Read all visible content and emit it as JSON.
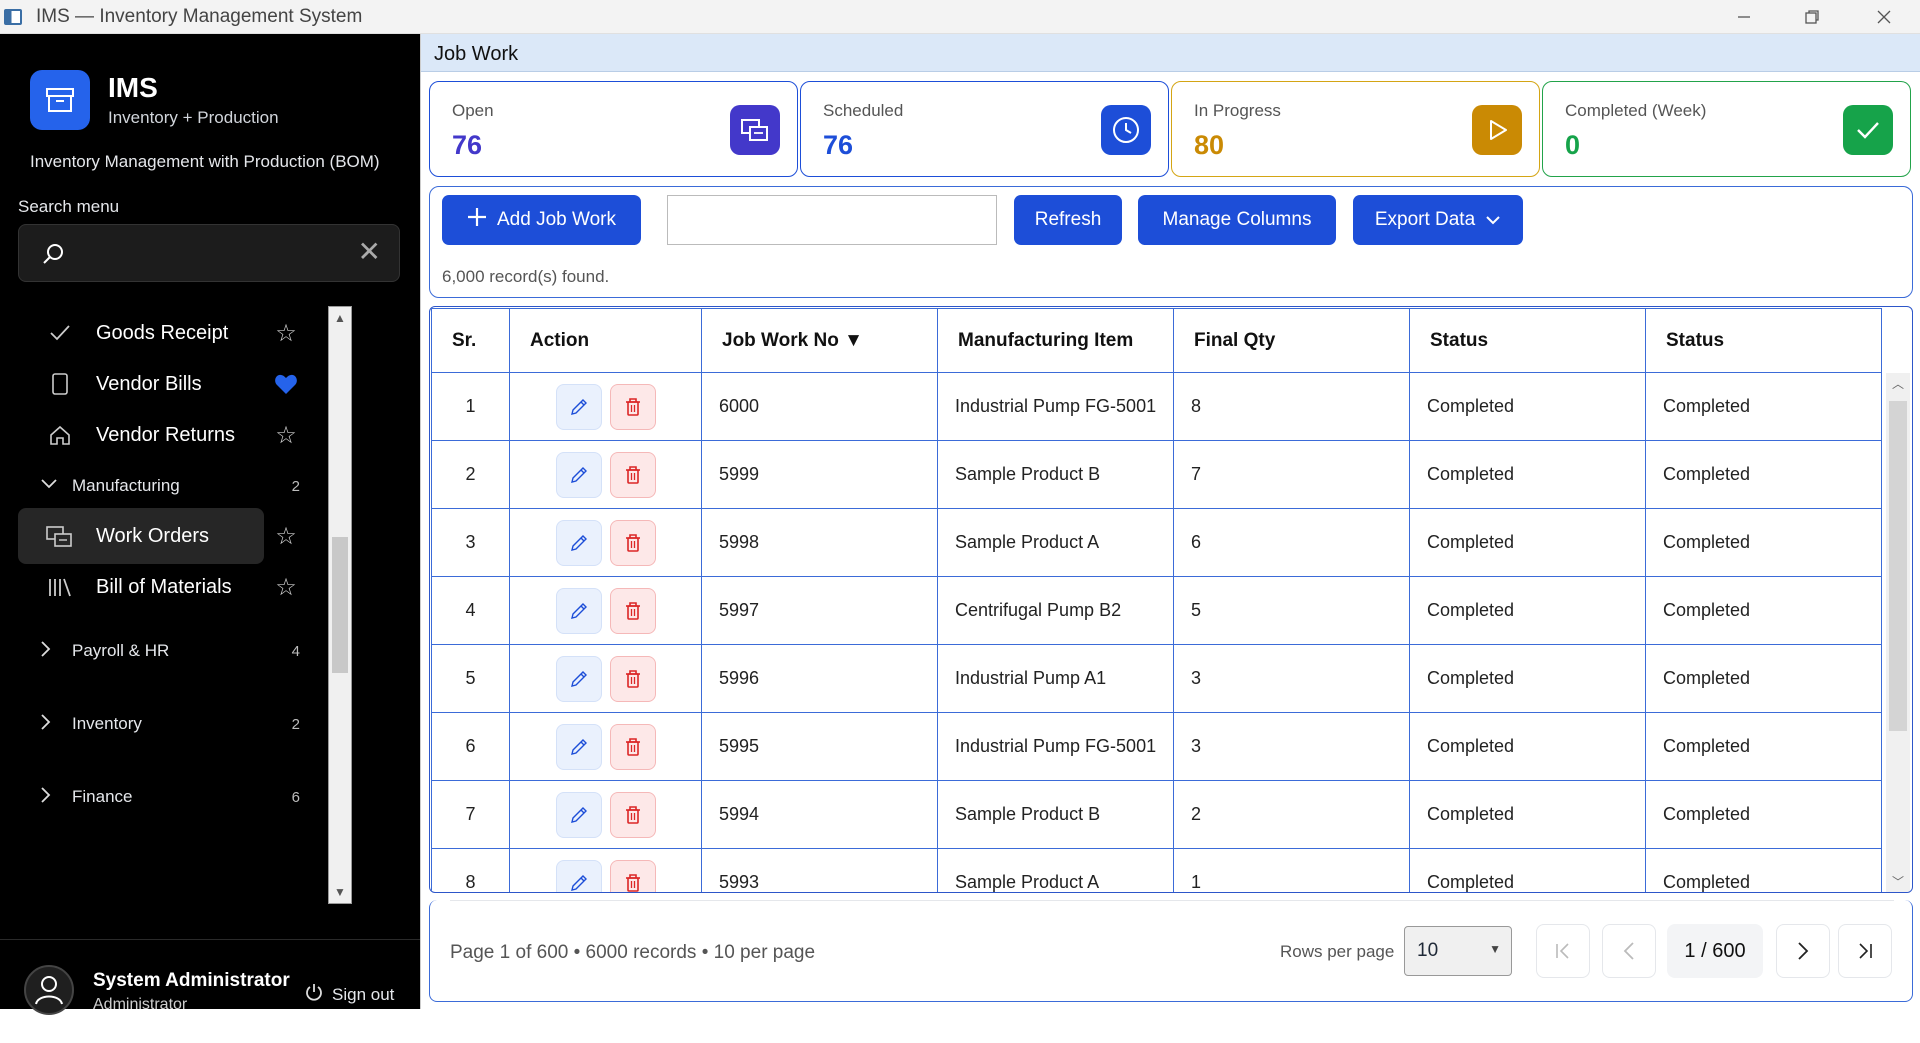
{
  "window": {
    "title": "IMS — Inventory Management System"
  },
  "brand": {
    "title": "IMS",
    "subtitle": "Inventory + Production",
    "tagline": "Inventory Management with Production (BOM)"
  },
  "search": {
    "label": "Search menu",
    "value": ""
  },
  "nav": {
    "items": [
      {
        "label": "Goods Receipt",
        "icon": "check-icon",
        "starred": false
      },
      {
        "label": "Vendor Bills",
        "icon": "document-icon",
        "starred": true
      },
      {
        "label": "Vendor Returns",
        "icon": "home-icon",
        "starred": false
      }
    ],
    "groups": [
      {
        "label": "Manufacturing",
        "count": "2",
        "expanded": true,
        "items": [
          {
            "label": "Work Orders",
            "icon": "work-orders-icon",
            "active": true
          },
          {
            "label": "Bill of Materials",
            "icon": "library-icon",
            "active": false
          }
        ]
      },
      {
        "label": "Payroll & HR",
        "count": "4",
        "expanded": false
      },
      {
        "label": "Inventory",
        "count": "2",
        "expanded": false
      },
      {
        "label": "Finance",
        "count": "6",
        "expanded": false
      }
    ]
  },
  "user": {
    "name": "System Administrator",
    "role": "Administrator",
    "signout": "Sign out"
  },
  "page": {
    "title": "Job Work"
  },
  "stats": [
    {
      "label": "Open",
      "value": "76",
      "color": "#4338ca",
      "icon": "work-orders-icon"
    },
    {
      "label": "Scheduled",
      "value": "76",
      "color": "#1d4ed8",
      "icon": "clock-icon"
    },
    {
      "label": "In Progress",
      "value": "80",
      "color": "#ca8a04",
      "icon": "play-icon"
    },
    {
      "label": "Completed (Week)",
      "value": "0",
      "color": "#16a34a",
      "icon": "check-icon"
    }
  ],
  "toolbar": {
    "add_label": "Add Job Work",
    "search_value": "",
    "refresh_label": "Refresh",
    "columns_label": "Manage Columns",
    "export_label": "Export Data",
    "records_text": "6,000 record(s) found."
  },
  "table": {
    "columns": [
      "Sr.",
      "Action",
      "Job Work No ▼",
      "Manufacturing Item",
      "Final Qty",
      "Status",
      "Status"
    ],
    "rows": [
      [
        "1",
        "6000",
        "Industrial Pump FG-5001",
        "8",
        "Completed",
        "Completed"
      ],
      [
        "2",
        "5999",
        "Sample Product B",
        "7",
        "Completed",
        "Completed"
      ],
      [
        "3",
        "5998",
        "Sample Product A",
        "6",
        "Completed",
        "Completed"
      ],
      [
        "4",
        "5997",
        "Centrifugal Pump B2",
        "5",
        "Completed",
        "Completed"
      ],
      [
        "5",
        "5996",
        "Industrial Pump A1",
        "3",
        "Completed",
        "Completed"
      ],
      [
        "6",
        "5995",
        "Industrial Pump FG-5001",
        "3",
        "Completed",
        "Completed"
      ],
      [
        "7",
        "5994",
        "Sample Product B",
        "2",
        "Completed",
        "Completed"
      ],
      [
        "8",
        "5993",
        "Sample Product A",
        "1",
        "Completed",
        "Completed"
      ]
    ]
  },
  "pager": {
    "info": "Page 1 of 600  •  6000 records  •  10 per page",
    "rows_label": "Rows per page",
    "rows_value": "10",
    "current": "1  /  600"
  },
  "colors": {
    "accent": "#1d4ed8",
    "sidebar_bg": "#000000",
    "header_bg": "#dbe8f8",
    "danger": "#dc2626"
  }
}
